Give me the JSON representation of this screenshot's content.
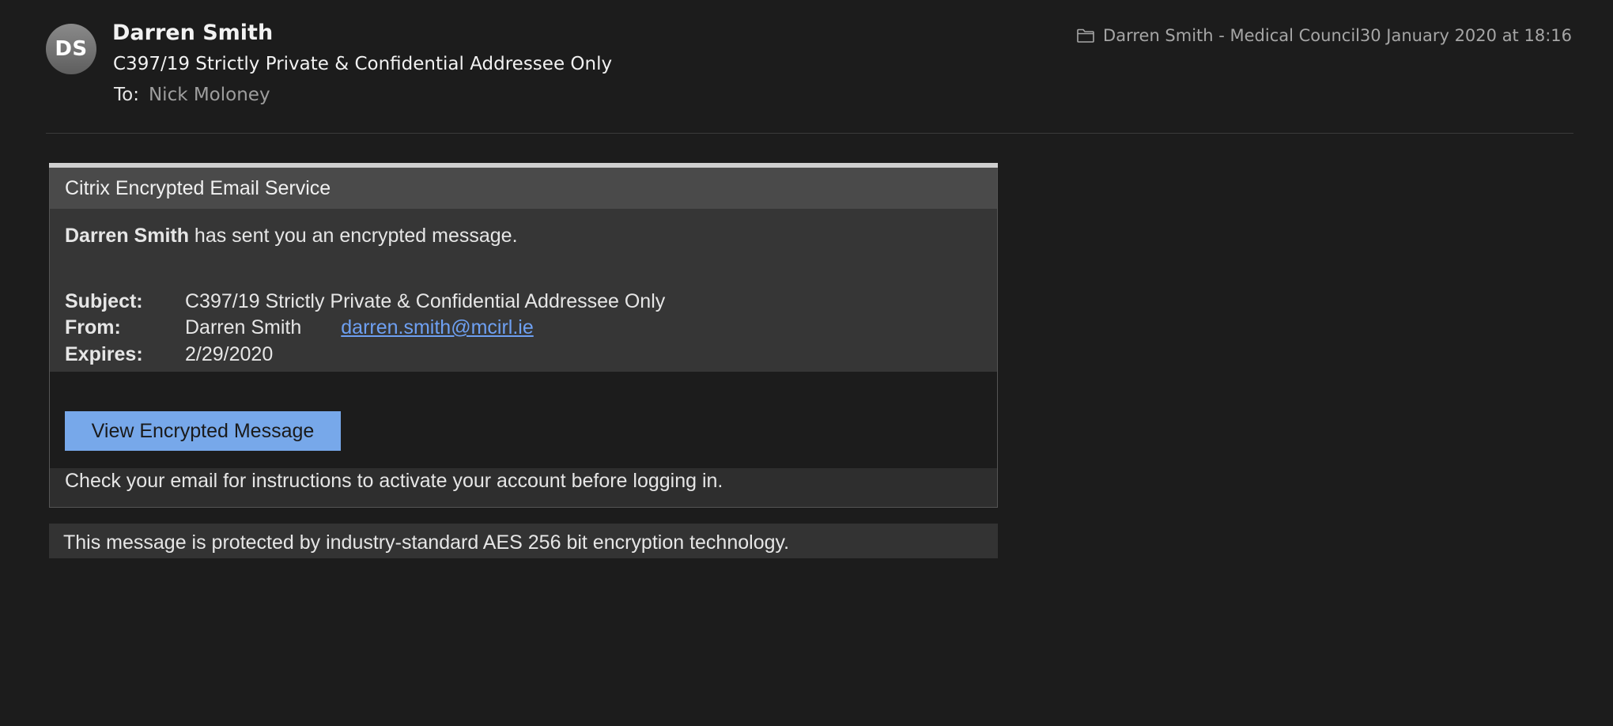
{
  "header": {
    "avatar_initials": "DS",
    "sender_name": "Darren Smith",
    "subject": "C397/19 Strictly Private & Confidential Addressee Only",
    "to_label": "To:",
    "to_value": "Nick Moloney",
    "mailbox": "Darren Smith - Medical Council",
    "mailbox_icon": "folder-icon",
    "date": "30 January 2020 at 18:16"
  },
  "message": {
    "service_name": "Citrix Encrypted Email Service",
    "intro_sender": "Darren Smith",
    "intro_text": " has sent you an encrypted message.",
    "subject_label": "Subject:",
    "subject_value": "C397/19 Strictly Private & Confidential Addressee Only",
    "from_label": "From:",
    "from_name": "Darren Smith",
    "from_email": "darren.smith@mcirl.ie",
    "expires_label": "Expires:",
    "expires_value": "2/29/2020",
    "button_label": "View Encrypted Message",
    "instructions": "Check your email for instructions to activate your account before logging in.",
    "footer": "This message is protected by industry-standard AES 256 bit encryption technology."
  },
  "colors": {
    "background": "#1c1c1c",
    "button": "#77a8ea",
    "link": "#6ea0f2"
  }
}
